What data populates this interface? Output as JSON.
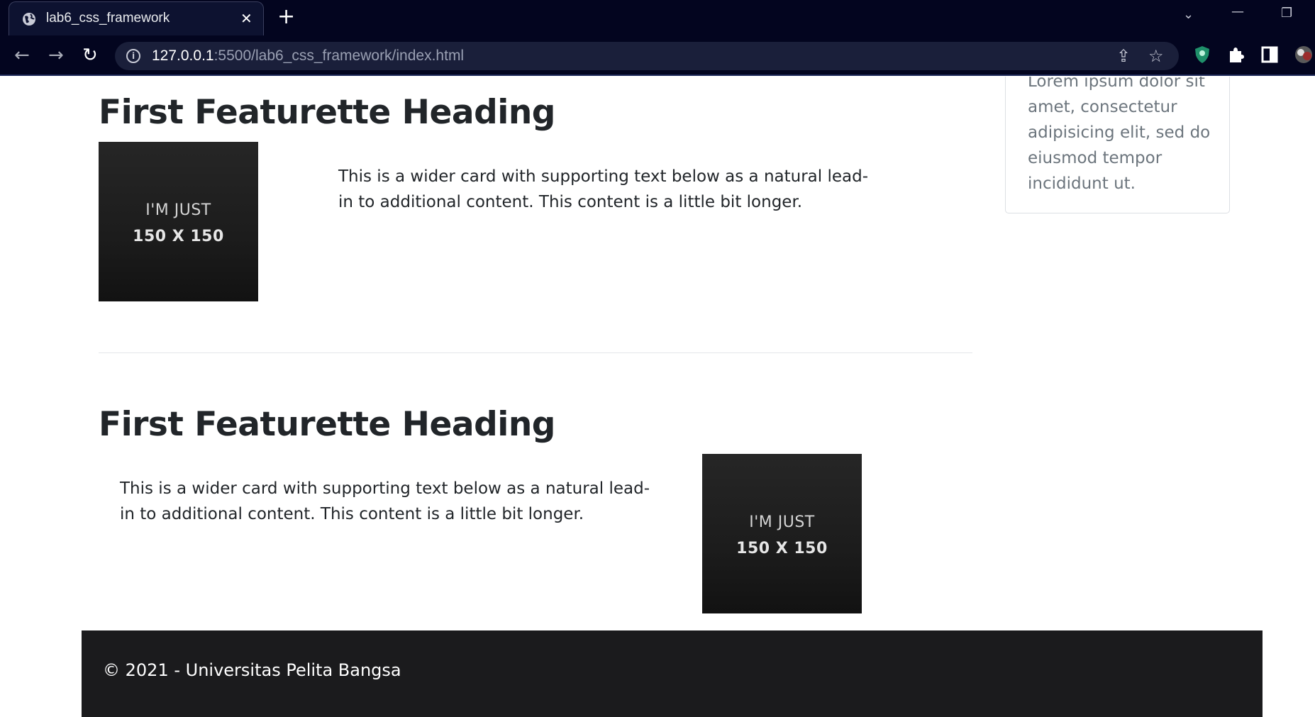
{
  "browser": {
    "tab": {
      "title": "lab6_css_framework",
      "favicon": "globe-icon",
      "close_glyph": "✕"
    },
    "new_tab_glyph": "+",
    "window_controls": {
      "tab_search_glyph": "⌄",
      "minimize_glyph": "—",
      "restore_glyph": "❐"
    },
    "nav": {
      "back_glyph": "←",
      "forward_glyph": "→",
      "reload_glyph": "↻"
    },
    "address_bar": {
      "info_glyph": "i",
      "url_host": "127.0.0.1",
      "url_rest": ":5500/lab6_css_framework/index.html",
      "share_glyph": "⇪",
      "bookmark_glyph": "☆"
    },
    "extensions": [
      "shield-extension-icon",
      "puzzle-icon",
      "side-panel-icon",
      "profile-avatar"
    ]
  },
  "page": {
    "sidebar_card": {
      "text": "Lorem ipsum dolor sit amet, consectetur adipisicing elit, sed do eiusmod tempor incididunt ut."
    },
    "featurettes": [
      {
        "heading": "First Featurette Heading",
        "text": "This is a wider card with supporting text below as a natural lead-in to additional content. This content is a little bit longer.",
        "image": {
          "line1": "I'M JUST",
          "line2": "150 X 150"
        }
      },
      {
        "heading": "First Featurette Heading",
        "text": "This is a wider card with supporting text below as a natural lead-in to additional content. This content is a little bit longer.",
        "image": {
          "line1": "I'M JUST",
          "line2": "150 X 150"
        }
      }
    ],
    "footer": {
      "text": "© 2021 - Universitas Pelita Bangsa"
    }
  },
  "colors": {
    "chrome_bg": "#03051f",
    "footer_bg": "#1b1b1d",
    "muted_text": "#6c757d",
    "body_text": "#212529"
  }
}
